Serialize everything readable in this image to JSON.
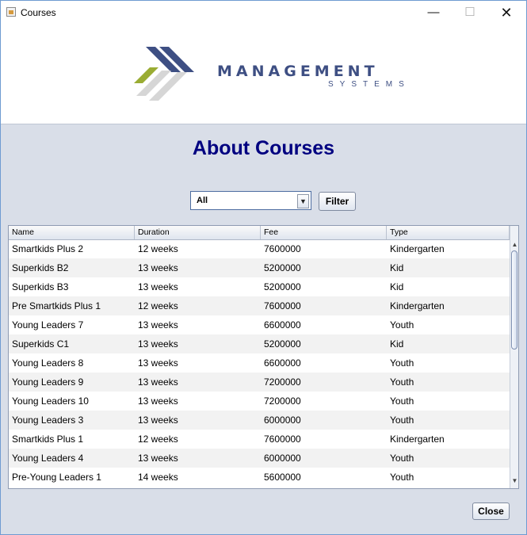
{
  "window": {
    "title": "Courses",
    "minimize": "—",
    "maximize": "☐",
    "close": "✕"
  },
  "brand": {
    "name": "MANAGEMENT",
    "subtitle": "SYSTEMS",
    "colors": {
      "navy": "#3e4f83",
      "olive": "#9aac33",
      "gray": "#d6d6d6"
    }
  },
  "page": {
    "heading": "About Courses"
  },
  "filter": {
    "selected": "All",
    "button": "Filter"
  },
  "table": {
    "columns": [
      "Name",
      "Duration",
      "Fee",
      "Type"
    ],
    "rows": [
      {
        "name": "Smartkids Plus 2",
        "duration": "12 weeks",
        "fee": "7600000",
        "type": "Kindergarten"
      },
      {
        "name": "Superkids B2",
        "duration": "13 weeks",
        "fee": "5200000",
        "type": "Kid"
      },
      {
        "name": "Superkids B3",
        "duration": "13 weeks",
        "fee": "5200000",
        "type": "Kid"
      },
      {
        "name": "Pre Smartkids Plus 1",
        "duration": "12 weeks",
        "fee": "7600000",
        "type": "Kindergarten"
      },
      {
        "name": "Young Leaders 7",
        "duration": "13 weeks",
        "fee": "6600000",
        "type": "Youth"
      },
      {
        "name": "Superkids C1",
        "duration": "13 weeks",
        "fee": "5200000",
        "type": "Kid"
      },
      {
        "name": "Young Leaders 8",
        "duration": "13 weeks",
        "fee": "6600000",
        "type": "Youth"
      },
      {
        "name": "Young Leaders 9",
        "duration": "13 weeks",
        "fee": "7200000",
        "type": "Youth"
      },
      {
        "name": "Young Leaders 10",
        "duration": "13 weeks",
        "fee": "7200000",
        "type": "Youth"
      },
      {
        "name": "Young Leaders 3",
        "duration": "13 weeks",
        "fee": "6000000",
        "type": "Youth"
      },
      {
        "name": "Smartkids Plus 1",
        "duration": "12 weeks",
        "fee": "7600000",
        "type": "Kindergarten"
      },
      {
        "name": "Young Leaders 4",
        "duration": "13 weeks",
        "fee": "6000000",
        "type": "Youth"
      },
      {
        "name": "Pre-Young Leaders 1",
        "duration": "14 weeks",
        "fee": "5600000",
        "type": "Youth"
      }
    ]
  },
  "footer": {
    "close_button": "Close"
  }
}
